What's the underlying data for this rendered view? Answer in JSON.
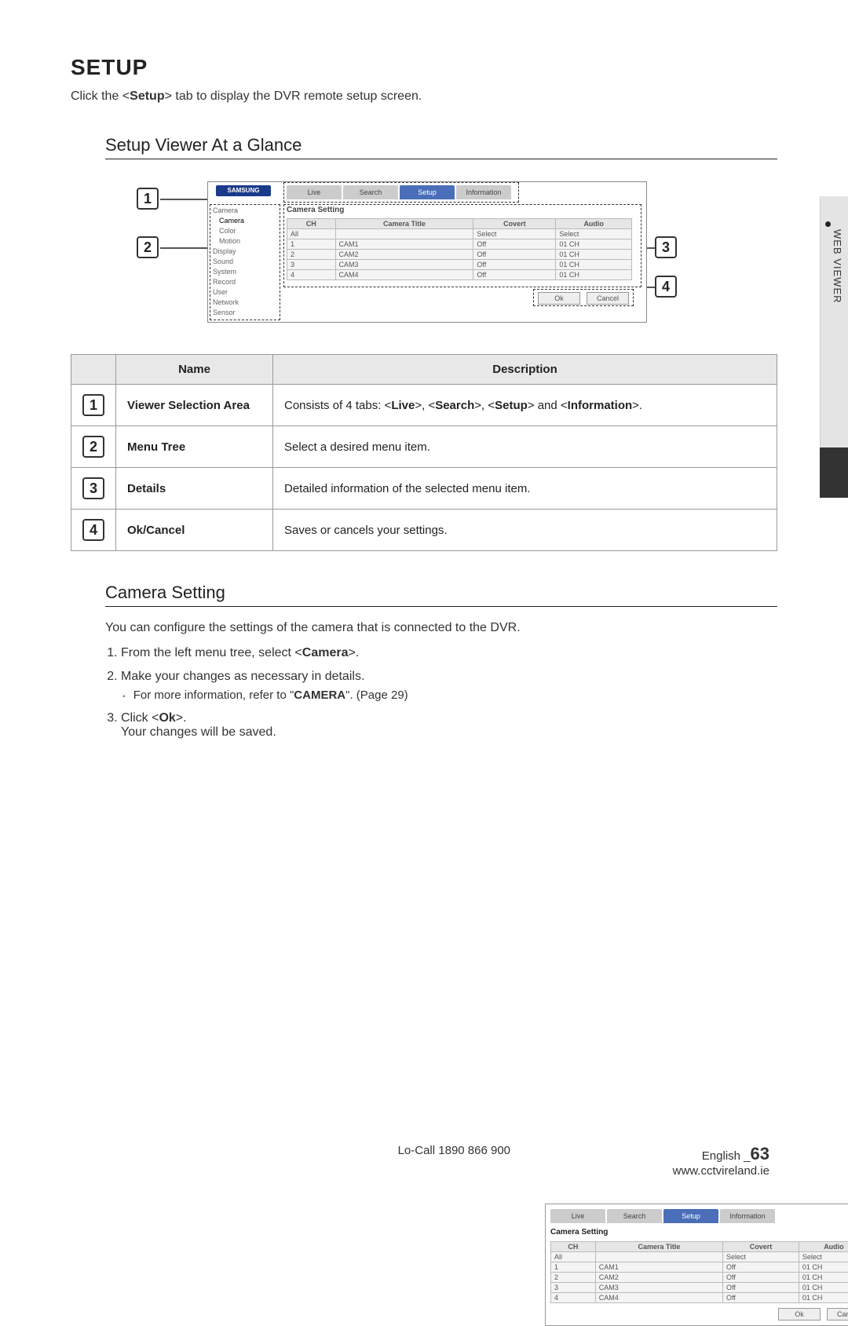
{
  "side_label": "WEB VIEWER",
  "heading": "SETUP",
  "intro_pre": "Click the <",
  "intro_bold": "Setup",
  "intro_post": "> tab to display the DVR remote setup screen.",
  "section1": "Setup Viewer At a Glance",
  "diagram": {
    "logo": "SAMSUNG",
    "tabs": [
      "Live",
      "Search",
      "Setup",
      "Information"
    ],
    "active_tab_index": 2,
    "panel_title": "Camera Setting",
    "tree": [
      "Camera",
      "Camera",
      "Color",
      "Motion",
      "Display",
      "Sound",
      "System",
      "Record",
      "User",
      "Network",
      "Sensor"
    ],
    "headers": [
      "CH",
      "Camera Title",
      "Covert",
      "Audio"
    ],
    "rows": [
      {
        "ch": "All",
        "title": "",
        "covert": "Select",
        "audio": "Select"
      },
      {
        "ch": "1",
        "title": "CAM1",
        "covert": "Off",
        "audio": "01 CH"
      },
      {
        "ch": "2",
        "title": "CAM2",
        "covert": "Off",
        "audio": "01 CH"
      },
      {
        "ch": "3",
        "title": "CAM3",
        "covert": "Off",
        "audio": "01 CH"
      },
      {
        "ch": "4",
        "title": "CAM4",
        "covert": "Off",
        "audio": "01 CH"
      }
    ],
    "ok": "Ok",
    "cancel": "Cancel"
  },
  "table": {
    "h1": "Name",
    "h2": "Description",
    "rows": [
      {
        "n": "1",
        "name": "Viewer Selection Area",
        "desc_pre": "Consists of 4 tabs: <",
        "b1": "Live",
        "m1": ">, <",
        "b2": "Search",
        "m2": ">, <",
        "b3": "Setup",
        "m3": "> and <",
        "b4": "Information",
        "m4": ">."
      },
      {
        "n": "2",
        "name": "Menu Tree",
        "desc": "Select a desired menu item."
      },
      {
        "n": "3",
        "name": "Details",
        "desc": "Detailed information of the selected menu item."
      },
      {
        "n": "4",
        "name": "Ok/Cancel",
        "desc": "Saves or cancels your settings."
      }
    ]
  },
  "section2": "Camera Setting",
  "cs_intro": "You can configure the settings of the camera that is connected to the DVR.",
  "steps": {
    "s1_pre": "From the left menu tree, select <",
    "s1_b": "Camera",
    "s1_post": ">.",
    "s2": "Make your changes as necessary in details.",
    "s2_sub_pre": "For more information, refer to \"",
    "s2_sub_b": "CAMERA",
    "s2_sub_post": "\". (Page 29)",
    "s3_pre": "Click <",
    "s3_b": "Ok",
    "s3_post": ">.",
    "s3_line2": "Your changes will be saved."
  },
  "footer": {
    "left": "Lo-Call  1890 866 900",
    "lang": "English _",
    "page": "63",
    "url": "www.cctvireland.ie"
  }
}
